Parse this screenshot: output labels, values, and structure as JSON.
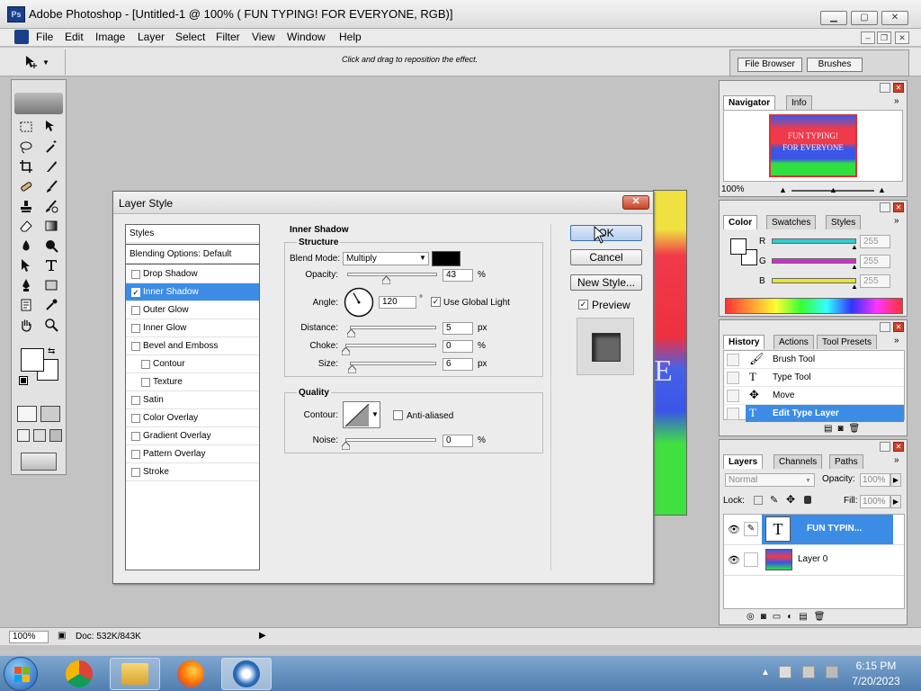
{
  "window": {
    "title": "Adobe Photoshop - [Untitled-1 @ 100% (  FUN TYPING! FOR EVERYONE, RGB)]",
    "logo": "Ps"
  },
  "menu": [
    "File",
    "Edit",
    "Image",
    "Layer",
    "Select",
    "Filter",
    "View",
    "Window",
    "Help"
  ],
  "options": {
    "hint": "Click and drag to reposition the effect.",
    "file_browser": "File Browser",
    "brushes": "Brushes"
  },
  "dialog": {
    "title": "Layer Style",
    "styles_header": "Styles",
    "blending_options": "Blending Options: Default",
    "styles": [
      {
        "label": "Drop Shadow",
        "checked": false,
        "indent": false,
        "selected": false
      },
      {
        "label": "Inner Shadow",
        "checked": true,
        "indent": false,
        "selected": true
      },
      {
        "label": "Outer Glow",
        "checked": false,
        "indent": false,
        "selected": false
      },
      {
        "label": "Inner Glow",
        "checked": false,
        "indent": false,
        "selected": false
      },
      {
        "label": "Bevel and Emboss",
        "checked": false,
        "indent": false,
        "selected": false
      },
      {
        "label": "Contour",
        "checked": false,
        "indent": true,
        "selected": false
      },
      {
        "label": "Texture",
        "checked": false,
        "indent": true,
        "selected": false
      },
      {
        "label": "Satin",
        "checked": false,
        "indent": false,
        "selected": false
      },
      {
        "label": "Color Overlay",
        "checked": false,
        "indent": false,
        "selected": false
      },
      {
        "label": "Gradient Overlay",
        "checked": false,
        "indent": false,
        "selected": false
      },
      {
        "label": "Pattern Overlay",
        "checked": false,
        "indent": false,
        "selected": false
      },
      {
        "label": "Stroke",
        "checked": false,
        "indent": false,
        "selected": false
      }
    ],
    "section_title": "Inner Shadow",
    "structure": {
      "title": "Structure",
      "blend_mode_label": "Blend Mode:",
      "blend_mode_value": "Multiply",
      "blend_color": "#000000",
      "opacity_label": "Opacity:",
      "opacity_value": "43",
      "opacity_level": 43,
      "percent": "%",
      "angle_label": "Angle:",
      "angle_value": "120",
      "angle_deg": 120,
      "degree": "°",
      "global_light_label": "Use Global Light",
      "global_light_checked": true,
      "distance_label": "Distance:",
      "distance_value": "5",
      "distance_level": 0.02,
      "px": "px",
      "choke_label": "Choke:",
      "choke_value": "0",
      "choke_level": 0,
      "size_label": "Size:",
      "size_value": "6",
      "size_level": 0.024
    },
    "quality": {
      "title": "Quality",
      "contour_label": "Contour:",
      "anti_aliased_label": "Anti-aliased",
      "anti_aliased_checked": false,
      "noise_label": "Noise:",
      "noise_value": "0",
      "noise_level": 0,
      "percent": "%"
    },
    "buttons": {
      "ok": "OK",
      "cancel": "Cancel",
      "new_style": "New Style..."
    },
    "preview_label": "Preview",
    "preview_checked": true
  },
  "navigator": {
    "tabs": [
      "Navigator",
      "Info"
    ],
    "thumb_line1": "FUN TYPING!",
    "thumb_line2": "FOR EVERYONE",
    "zoom": "100%"
  },
  "color": {
    "tabs": [
      "Color",
      "Swatches",
      "Styles"
    ],
    "channels": [
      {
        "label": "R",
        "value": "255",
        "color": "#33cccc"
      },
      {
        "label": "G",
        "value": "255",
        "color": "#cc33cc"
      },
      {
        "label": "B",
        "value": "255",
        "color": "#e6e633"
      }
    ]
  },
  "history": {
    "tabs": [
      "History",
      "Actions",
      "Tool Presets"
    ],
    "items": [
      {
        "label": "Brush Tool",
        "icon": "brush-icon",
        "selected": false
      },
      {
        "label": "Type Tool",
        "icon": "type-tool-icon",
        "selected": false
      },
      {
        "label": "Move",
        "icon": "move-tool-icon",
        "selected": false
      },
      {
        "label": "Edit Type Layer",
        "icon": "type-tool-icon",
        "selected": true
      }
    ]
  },
  "layers": {
    "tabs": [
      "Layers",
      "Channels",
      "Paths"
    ],
    "blend_mode": "Normal",
    "opacity_label": "Opacity:",
    "opacity_value": "100%",
    "lock_label": "Lock:",
    "fill_label": "Fill:",
    "fill_value": "100%",
    "items": [
      {
        "name": "FUN TYPIN...",
        "type": "text",
        "selected": true
      },
      {
        "name": "Layer 0",
        "type": "image",
        "selected": false
      }
    ]
  },
  "status": {
    "zoom": "100%",
    "doc": "Doc: 532K/843K"
  },
  "taskbar": {
    "time": "6:15 PM",
    "date": "7/20/2023"
  },
  "canvas": {
    "letter": "E"
  }
}
